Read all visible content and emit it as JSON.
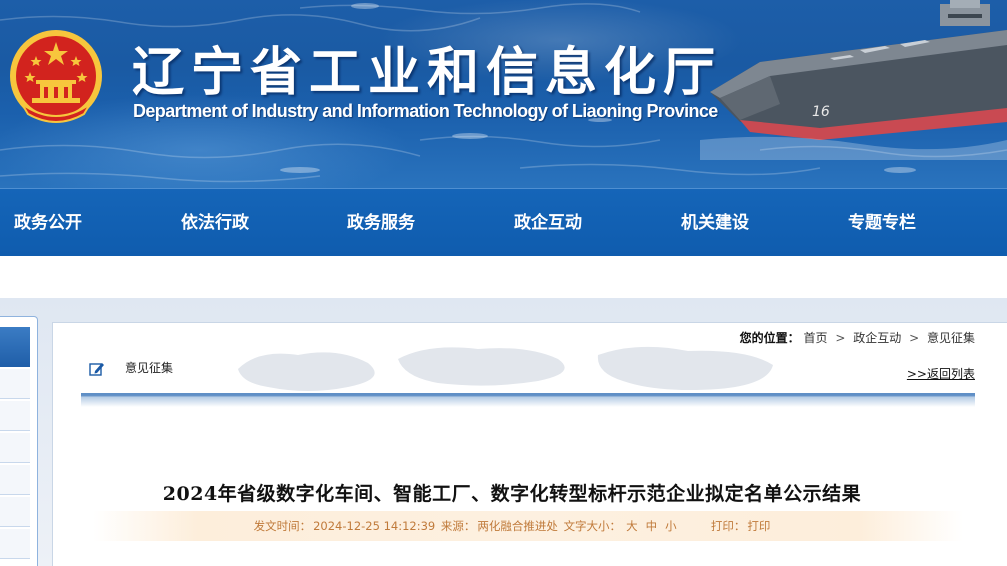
{
  "header": {
    "title_cn": "辽宁省工业和信息化厅",
    "title_en": "Department of Industry and Information Technology of Liaoning Province",
    "colors": {
      "banner": "#1d5ea9",
      "nav": "#1565b8",
      "emblem_red": "#d2231e",
      "emblem_gold": "#f7c63d"
    }
  },
  "nav": {
    "items": [
      {
        "label": "政务公开"
      },
      {
        "label": "依法行政"
      },
      {
        "label": "政务服务"
      },
      {
        "label": "政企互动"
      },
      {
        "label": "机关建设"
      },
      {
        "label": "专题专栏"
      }
    ]
  },
  "location": {
    "label": "您的位置：",
    "crumbs": [
      "首页",
      "政企互动",
      "意见征集"
    ],
    "separator": ">"
  },
  "section": {
    "label": "意见征集",
    "back_link": ">>返回列表"
  },
  "article": {
    "title": "2024年省级数字化车间、智能工厂、数字化转型标杆示范企业拟定名单公示结果",
    "meta": {
      "date_label": "发文时间：",
      "date": "2024-12-25 14:12:39",
      "source_label": "来源：",
      "source": "两化融合推进处",
      "font_label": "文字大小：",
      "font_large": "大",
      "font_medium": "中",
      "font_small": "小",
      "print_label": "打印：",
      "print": "打印"
    }
  }
}
